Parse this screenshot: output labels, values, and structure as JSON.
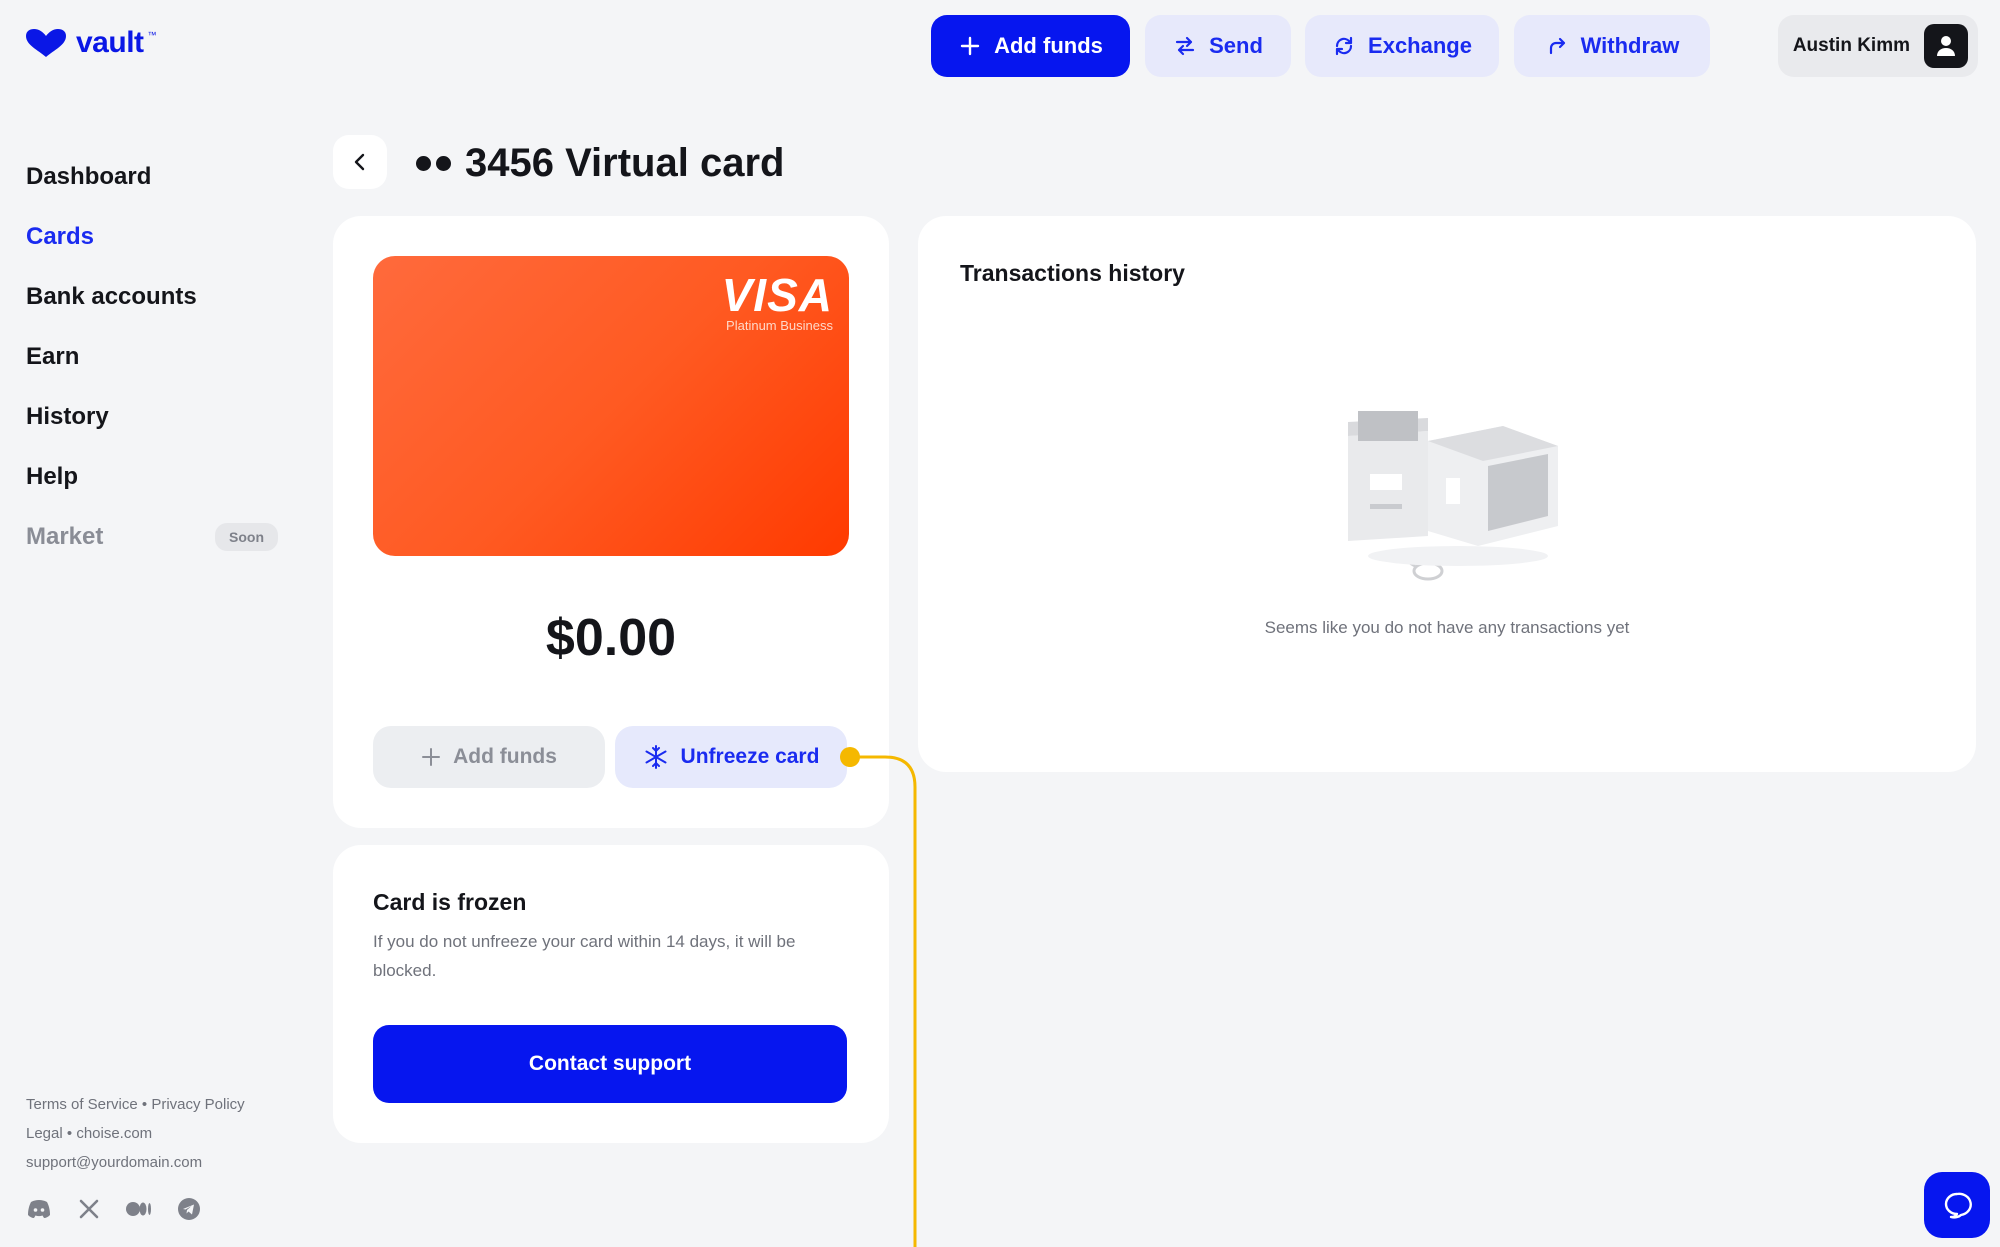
{
  "app": {
    "logo_text": "vault",
    "logo_tm": "™"
  },
  "topbar": {
    "add_funds": "Add funds",
    "send": "Send",
    "exchange": "Exchange",
    "withdraw": "Withdraw",
    "user_name": "Austin Kimm"
  },
  "sidebar": {
    "items": [
      {
        "label": "Dashboard"
      },
      {
        "label": "Cards"
      },
      {
        "label": "Bank accounts"
      },
      {
        "label": "Earn"
      },
      {
        "label": "History"
      },
      {
        "label": "Help"
      },
      {
        "label": "Market",
        "badge": "Soon"
      }
    ],
    "active": "Cards",
    "legal": {
      "terms": "Terms of Service",
      "privacy": "Privacy Policy",
      "legal": "Legal",
      "site": "choise.com",
      "email": "support@yourdomain.com",
      "separator": "•"
    },
    "socials": [
      "discord-icon",
      "x-icon",
      "medium-icon",
      "telegram-icon"
    ]
  },
  "page": {
    "title_dots": "••",
    "title": "3456 Virtual card"
  },
  "card": {
    "brand": "VISA",
    "brand_sub": "Platinum Business",
    "balance": "$0.00",
    "add_funds": "Add funds",
    "unfreeze": "Unfreeze card",
    "gradient": [
      "#ff6a3c",
      "#ff3a00"
    ]
  },
  "frozen": {
    "title": "Card is frozen",
    "text": "If you do not unfreeze your card within 14 days, it will be blocked.",
    "button": "Contact support"
  },
  "transactions": {
    "title": "Transactions history",
    "empty_text": "Seems like you do not have any transactions yet"
  },
  "colors": {
    "accent": "#0616ef",
    "accent_soft": "#e6e9fc",
    "annotation": "#f5b800",
    "background": "#f4f5f7"
  }
}
